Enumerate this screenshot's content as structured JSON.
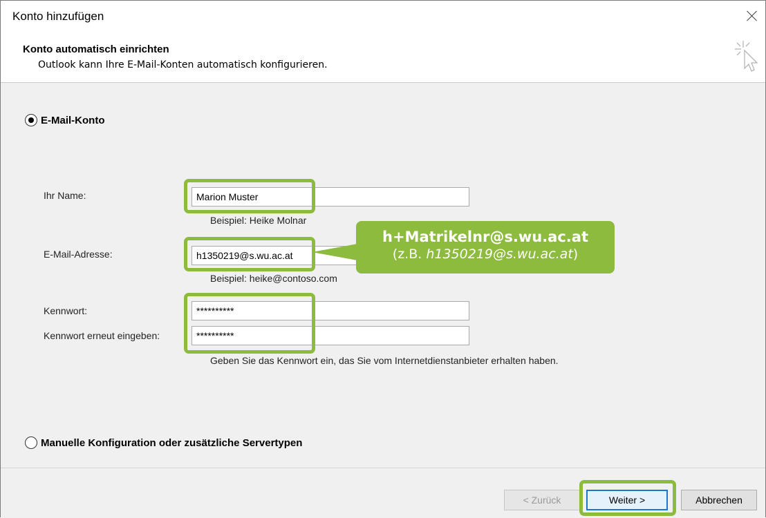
{
  "window": {
    "title": "Konto hinzufügen"
  },
  "header": {
    "title": "Konto automatisch einrichten",
    "subtitle": "Outlook kann Ihre E-Mail-Konten automatisch konfigurieren."
  },
  "email_account": {
    "label": "E-Mail-Konto",
    "selected": true
  },
  "form": {
    "name_label": "Ihr Name:",
    "name_value": "Marion Muster",
    "name_hint": "Beispiel: Heike Molnar",
    "email_label": "E-Mail-Adresse:",
    "email_value": "h1350219@s.wu.ac.at",
    "email_hint": "Beispiel: heike@contoso.com",
    "password_label": "Kennwort:",
    "password_value": "**********",
    "password_repeat_label": "Kennwort erneut eingeben:",
    "password_repeat_value": "**********",
    "password_hint": "Geben Sie das Kennwort ein, das Sie vom Internetdienstanbieter erhalten haben."
  },
  "callout": {
    "main": "h+Matrikelnr@s.wu.ac.at",
    "sub_prefix": "(z.B. ",
    "sub_example": "h1350219@s.wu.ac.at",
    "sub_suffix": ")"
  },
  "manual_config": {
    "label": "Manuelle Konfiguration oder zusätzliche Servertypen",
    "selected": false
  },
  "buttons": {
    "back": "< Zurück",
    "next": "Weiter >",
    "cancel": "Abbrechen"
  },
  "colors": {
    "highlight": "#8dbb3d",
    "primary_border": "#1b75d0"
  }
}
